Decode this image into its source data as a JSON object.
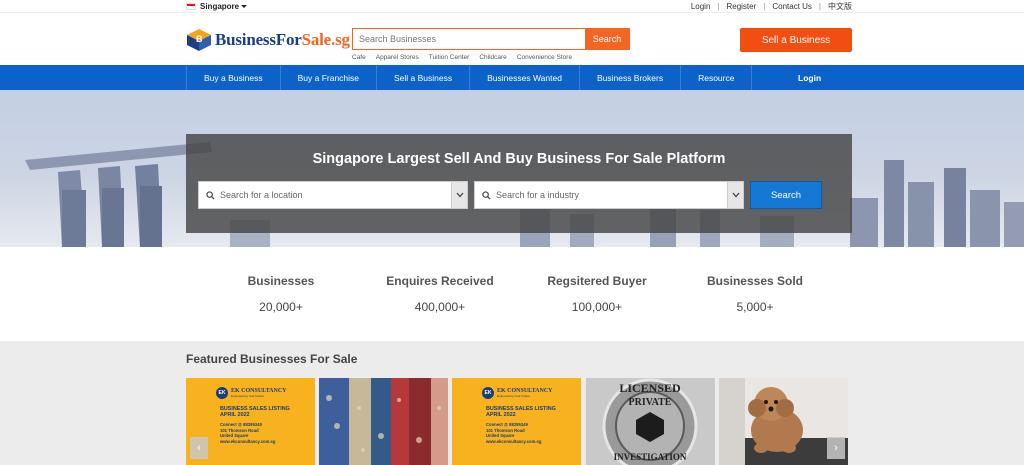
{
  "topbar": {
    "region": "Singapore",
    "links": [
      "Login",
      "Register",
      "Contact Us",
      "中文版"
    ]
  },
  "header": {
    "logo_main": "BusinessFor",
    "logo_accent": "Sale.sg",
    "search_placeholder": "Search Businesses",
    "search_button": "Search",
    "quick_links": [
      "Cafe",
      "Apparel Stores",
      "Tuition Center",
      "Childcare",
      "Convenience Store"
    ],
    "sell_button": "Sell a Business"
  },
  "nav": {
    "items": [
      "Buy a Business",
      "Buy a Franchise",
      "Sell a Business",
      "Businesses Wanted",
      "Business Brokers",
      "Resource"
    ],
    "login": "Login"
  },
  "hero": {
    "title": "Singapore Largest Sell And Buy Business For Sale Platform",
    "location_placeholder": "Search for a location",
    "industry_placeholder": "Search for a industry",
    "search_button": "Search"
  },
  "stats": [
    {
      "label": "Businesses",
      "value": "20,000+"
    },
    {
      "label": "Enquires Received",
      "value": "400,000+"
    },
    {
      "label": "Regsitered Buyer",
      "value": "100,000+"
    },
    {
      "label": "Businesses Sold",
      "value": "5,000+"
    }
  ],
  "featured": {
    "title": "Featured Businesses For Sale",
    "ek_card": {
      "logo_initials": "EK",
      "company": "EK CONSULTANCY",
      "tagline": "Empowering Your Future",
      "heading_1": "BUSINESS SALES LISTING",
      "heading_2": "APRIL 2022",
      "contact": "Connect @ 88295349",
      "address_1": "101 Thomson Road",
      "address_2": "United Square",
      "website": "www.ekconsultancy.com.sg"
    },
    "badge_text_1": "LICENSED",
    "badge_text_2": "PRIVATE",
    "badge_text_3": "INVESTIGATION",
    "prev_icon": "chevron-left-icon",
    "next_icon": "chevron-right-icon"
  },
  "colors": {
    "brand_blue": "#0d62c9",
    "brand_orange": "#f26522",
    "logo_navy": "#1a3f86"
  }
}
